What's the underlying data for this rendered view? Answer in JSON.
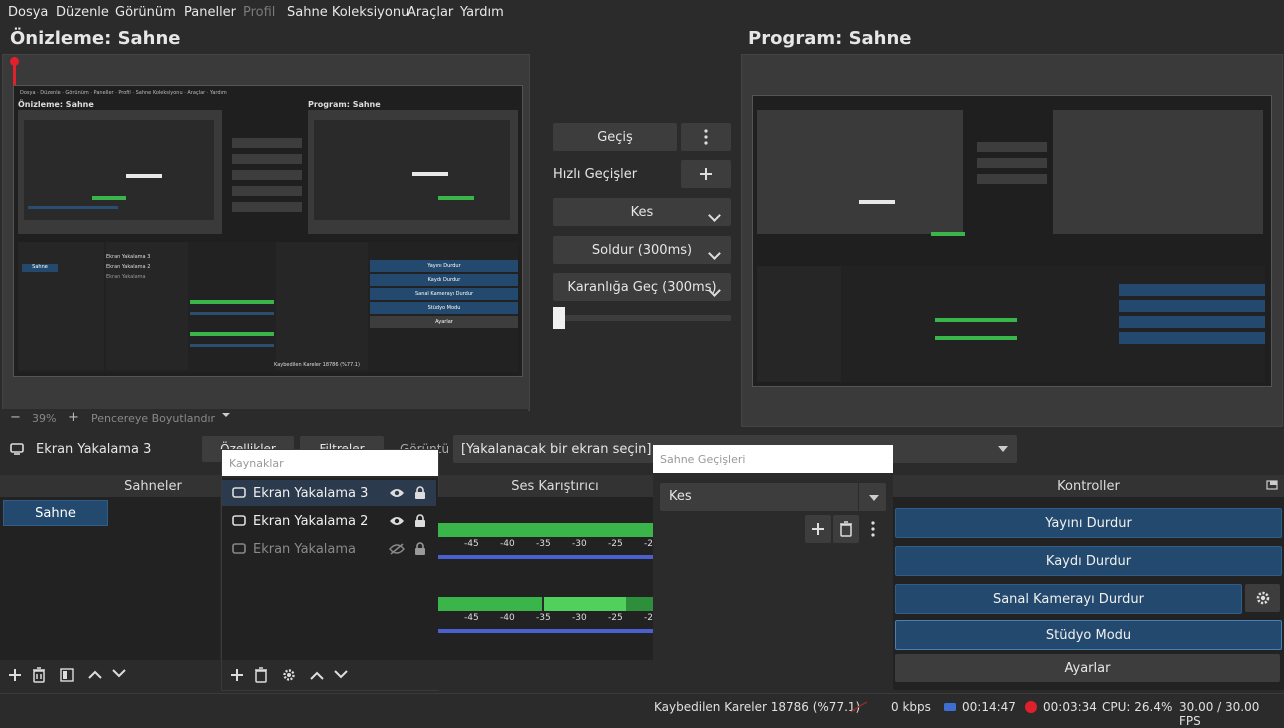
{
  "menu": [
    "Dosya",
    "Düzenle",
    "Görünüm",
    "Paneller",
    "Profil",
    "Sahne Koleksiyonu",
    "Araçlar",
    "Yardım"
  ],
  "preview_title": "Önizleme: Sahne",
  "program_title": "Program: Sahne",
  "nested": {
    "menu": [
      "Dosya",
      "Düzenle",
      "Görünüm",
      "Paneller",
      "Profil",
      "Sahne Koleksiyonu",
      "Araçlar",
      "Yardım"
    ],
    "preview_title": "Önizleme: Sahne",
    "program_title": "Program: Sahne",
    "sources": [
      "Ekran Yakalama 3",
      "Ekran Yakalama 2",
      "Ekran Yakalama"
    ],
    "controls": [
      "Yayını Durdur",
      "Kaydı Durdur",
      "Sanal Kamerayı Durdur",
      "Stüdyo Modu",
      "Ayarlar"
    ],
    "scene": "Sahne",
    "status": "Kaybedilen Kareler 18786 (%77.1)"
  },
  "zoom_bar": {
    "minus": "−",
    "zoom": "39%",
    "plus": "+",
    "fit": "Pencereye Boyutlandır"
  },
  "transitions": {
    "transition_button": "Geçiş",
    "quick_transitions": "Hızlı Geçişler",
    "cut": "Kes",
    "fade": "Soldur (300ms)",
    "fade_to_black": "Karanlığa Geç (300ms)",
    "t_bar": 0.0
  },
  "source_bar": {
    "selected": "Ekran Yakalama 3",
    "properties": "Özellikler",
    "filters": "Filtreler",
    "display_label": "Görüntü",
    "display_value": "[Yakalanacak bir ekran seçin]"
  },
  "docks": {
    "scenes": {
      "title": "Sahneler",
      "items": [
        "Sahne"
      ]
    },
    "sources": {
      "title": "Kaynaklar",
      "items": [
        {
          "name": "Ekran Yakalama 3",
          "visible": true,
          "selected": true
        },
        {
          "name": "Ekran Yakalama 2",
          "visible": true,
          "selected": false
        },
        {
          "name": "Ekran Yakalama",
          "visible": false,
          "selected": false
        }
      ]
    },
    "mixer": {
      "title": "Ses Karıştırıcı",
      "ticks": [
        "-45",
        "-40",
        "-35",
        "-30",
        "-25",
        "-2"
      ]
    },
    "transitions": {
      "title": "Sahne Geçişleri",
      "value": "Kes"
    },
    "controls": {
      "title": "Kontroller",
      "buttons": [
        "Yayını Durdur",
        "Kaydı Durdur",
        "Sanal Kamerayı Durdur",
        "Stüdyo Modu",
        "Ayarlar"
      ]
    }
  },
  "status": {
    "dropped": "Kaybedilen Kareler 18786 (%77.1)",
    "kbps": "0 kbps",
    "stream_time": "00:14:47",
    "rec_time": "00:03:34",
    "cpu": "CPU: 26.4%",
    "fps": "30.00 / 30.00 FPS"
  },
  "colors": {
    "accent_blue": "#234a6e",
    "meter_green": "#39b54a",
    "meter_blue": "#4a5fd0",
    "rec_red": "#e0202a"
  }
}
